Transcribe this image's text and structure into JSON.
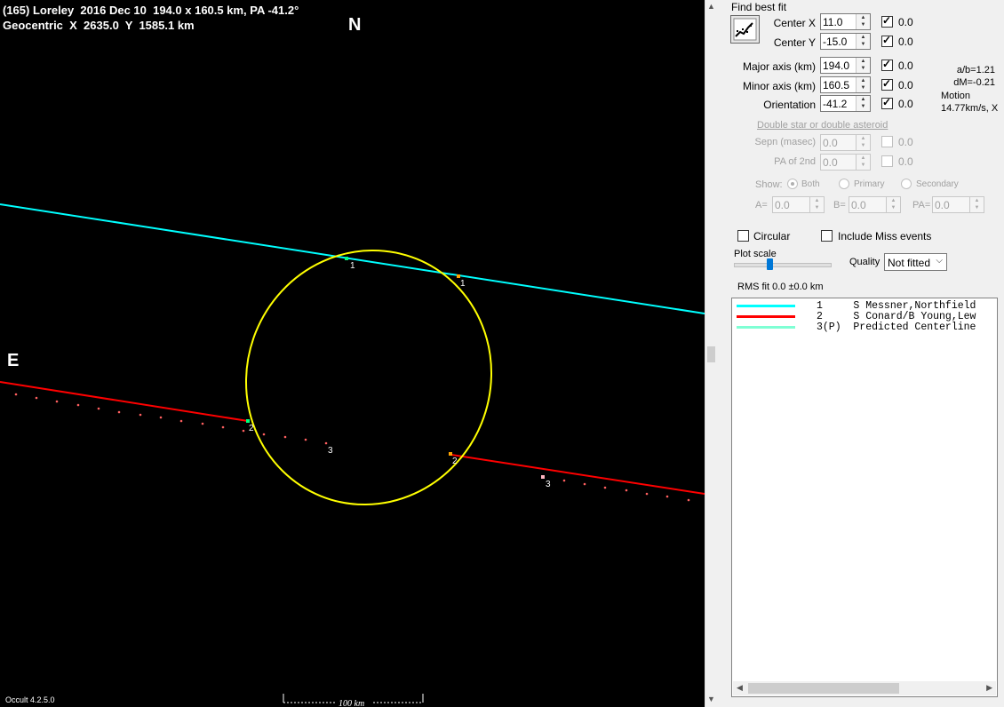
{
  "plot": {
    "title_line1": "(165) Loreley  2016 Dec 10  194.0 x 160.5 km, PA -41.2°",
    "title_line2": "Geocentric  X  2635.0  Y  1585.1 km",
    "north": "N",
    "east": "E",
    "version": "Occult 4.2.5.0",
    "scale_label": "100 km",
    "colors": {
      "ellipse": "#ffff00",
      "chord1": "#00ffff",
      "chord2": "#ff0000",
      "background": "#000000"
    },
    "chord_labels": {
      "c1a": "1",
      "c1b": "1",
      "c2a": "2",
      "c2b": "2",
      "c3a": "3",
      "c3b": "3"
    }
  },
  "panel": {
    "find_best_fit": "Find best fit",
    "fit_icon": "chart-fit-icon",
    "params": [
      {
        "label": "Center X",
        "value": "11.0",
        "check_label": "0.0",
        "checked": true
      },
      {
        "label": "Center Y",
        "value": "-15.0",
        "check_label": "0.0",
        "checked": true
      },
      {
        "label": "Major axis (km)",
        "value": "194.0",
        "check_label": "0.0",
        "checked": true
      },
      {
        "label": "Minor axis (km)",
        "value": "160.5",
        "check_label": "0.0",
        "checked": true
      },
      {
        "label": "Orientation",
        "value": "-41.2",
        "check_label": "0.0",
        "checked": true
      }
    ],
    "ratio_ab": "a/b=1.21",
    "dm": "dM=-0.21",
    "motion_label": "Motion",
    "motion_value": "14.77km/s, X",
    "double_star_link": "Double star  or  double asteroid",
    "sepn_label": "Sepn (masec)",
    "sepn_value": "0.0",
    "sepn_check": "0.0",
    "pa2_label": "PA of 2nd",
    "pa2_value": "0.0",
    "pa2_check": "0.0",
    "show_label": "Show:",
    "show_options": [
      "Both",
      "Primary",
      "Secondary"
    ],
    "a_label": "A=",
    "a_value": "0.0",
    "b_label": "B=",
    "b_value": "0.0",
    "pa_label": "PA=",
    "pa_value": "0.0",
    "circular_label": "Circular",
    "include_miss_label": "Include Miss events",
    "plot_scale_label": "Plot scale",
    "quality_label": "Quality",
    "quality_value": "Not fitted",
    "rms_fit": "RMS fit  0.0 ±0.0 km",
    "list": [
      {
        "text": "1     S Messner,Northfield",
        "color": "#00ffff"
      },
      {
        "text": "2     S Conard/B Young,Lew",
        "color": "#ff0000"
      },
      {
        "text": "3(P)  Predicted Centerline",
        "color": "#7fffd4"
      }
    ]
  }
}
